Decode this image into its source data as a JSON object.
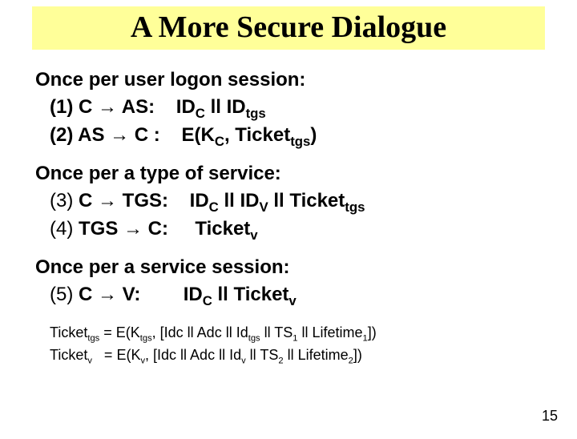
{
  "title": "A More Secure Dialogue",
  "sections": {
    "s1": {
      "label": "Once per user logon session:",
      "lines": {
        "l1": {
          "num": "(1) ",
          "lhs": "C ",
          "arrow": "→",
          "rhs": " AS:",
          "gap": "    ",
          "pre": "ID",
          "sub1": "C",
          "mid": " ll ID",
          "sub2": "tgs",
          "post": ""
        },
        "l2": {
          "num": "(2) ",
          "lhs": "AS ",
          "arrow": "→",
          "rhs": " C :",
          "gap": "    ",
          "pre": "E(K",
          "sub1": "C",
          "mid": ", Ticket",
          "sub2": "tgs",
          "post": ")"
        }
      }
    },
    "s2": {
      "label": "Once per a type of service:",
      "lines": {
        "l3": {
          "num": "(3) ",
          "lhs": "C ",
          "arrow": "→",
          "rhs": " TGS:",
          "gap": "    ",
          "pre": "ID",
          "sub1": "C",
          "mid": " ll ID",
          "sub2": "V",
          "mid2": " ll Ticket",
          "sub3": "tgs",
          "post": ""
        },
        "l4": {
          "num": "(4) ",
          "lhs": "TGS ",
          "arrow": "→",
          "rhs": " C:",
          "gap": "     ",
          "pre": "Ticket",
          "sub1": "v",
          "post": ""
        }
      }
    },
    "s3": {
      "label": "Once per a service session:",
      "lines": {
        "l5": {
          "num": "(5) ",
          "lhs": "C ",
          "arrow": "→",
          "rhs": " V:",
          "gap": "        ",
          "pre": "ID",
          "sub1": "C",
          "mid": " ll Ticket",
          "sub2": "v",
          "post": ""
        }
      }
    }
  },
  "footer": {
    "f1": {
      "a": "Ticket",
      "as": "tgs",
      "b": " = E(K",
      "bs": "tgs",
      "c": ", [Idc ll Adc ll Id",
      "cs": "tgs",
      "d": " ll TS",
      "ds": "1",
      "e": " ll Lifetime",
      "es": "1",
      "f": "])"
    },
    "f2": {
      "a": "Ticket",
      "as": "v",
      "b": "   = E(K",
      "bs": "v",
      "c": ", [Idc ll Adc ll Id",
      "cs": "v",
      "d": " ll TS",
      "ds": "2",
      "e": " ll Lifetime",
      "es": "2",
      "f": "])"
    }
  },
  "pagenum": "15"
}
